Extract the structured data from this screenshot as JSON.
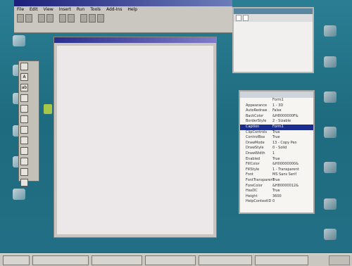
{
  "window": {
    "title": "",
    "menu": [
      "File",
      "Edit",
      "View",
      "Insert",
      "Run",
      "Tools",
      "Add-Ins",
      "Help"
    ],
    "position_text": "",
    "size_text": ""
  },
  "project": {
    "tabs": [
      "",
      ""
    ]
  },
  "toolbox": {
    "tools": [
      "",
      "A",
      "ab",
      "",
      "",
      "",
      "",
      "",
      "",
      "",
      "",
      ""
    ]
  },
  "properties": {
    "title": "",
    "rows": [
      {
        "k": "",
        "v": "Form1"
      },
      {
        "k": "Appearance",
        "v": "1 - 3D"
      },
      {
        "k": "AutoRedraw",
        "v": "False"
      },
      {
        "k": "BackColor",
        "v": "&H8000000F&"
      },
      {
        "k": "BorderStyle",
        "v": "2 - Sizable"
      },
      {
        "k": "Caption",
        "v": "Form1",
        "sel": true
      },
      {
        "k": "ClipControls",
        "v": "True"
      },
      {
        "k": "ControlBox",
        "v": "True"
      },
      {
        "k": "DrawMode",
        "v": "13 - Copy Pen"
      },
      {
        "k": "DrawStyle",
        "v": "0 - Solid"
      },
      {
        "k": "DrawWidth",
        "v": "1"
      },
      {
        "k": "Enabled",
        "v": "True"
      },
      {
        "k": "FillColor",
        "v": "&H00000000&"
      },
      {
        "k": "FillStyle",
        "v": "1 - Transparent"
      },
      {
        "k": "Font",
        "v": "MS Sans Serif"
      },
      {
        "k": "FontTransparent",
        "v": "True"
      },
      {
        "k": "ForeColor",
        "v": "&H80000012&"
      },
      {
        "k": "HasDC",
        "v": "True"
      },
      {
        "k": "Height",
        "v": "3600"
      },
      {
        "k": "HelpContextID",
        "v": "0"
      }
    ]
  },
  "overlay_text": "",
  "taskbar": {
    "start": "",
    "tasks": [
      "",
      "",
      "",
      "",
      ""
    ]
  },
  "colors": {
    "desktop": "#1f6f83",
    "title_blue": "#1c1f7a",
    "overlay_red": "#e0211b"
  }
}
